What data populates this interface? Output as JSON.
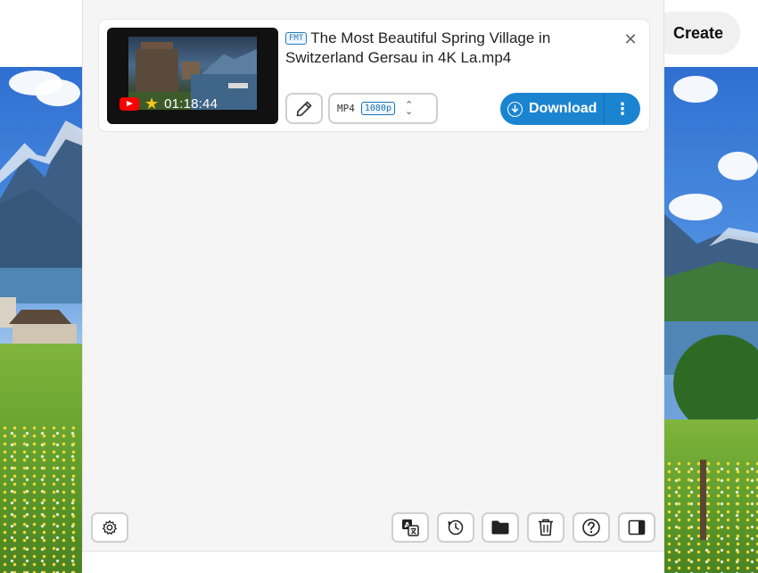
{
  "background": {
    "create_label": "Create"
  },
  "item": {
    "format_tag": "FMT",
    "title": "The Most Beautiful Spring Village in Switzerland Gersau in 4K La.mp4",
    "duration": "01:18:44",
    "close_glyph": "✕",
    "format": "MP4",
    "resolution": "1080p",
    "download_label": "Download",
    "more_glyph": "⋮"
  },
  "icons": {
    "source": "youtube-icon",
    "rating": "star-icon",
    "edit": "pencil-icon",
    "settings": "gear-icon",
    "translate": "translate-icon",
    "history": "clock-icon",
    "folder": "folder-icon",
    "trash": "trash-icon",
    "help": "help-icon",
    "sidebar": "sidebar-toggle-icon"
  },
  "colors": {
    "accent": "#1b84d0",
    "badge": "#1a73b8",
    "youtube": "#ff0000",
    "star": "#f5c518"
  }
}
